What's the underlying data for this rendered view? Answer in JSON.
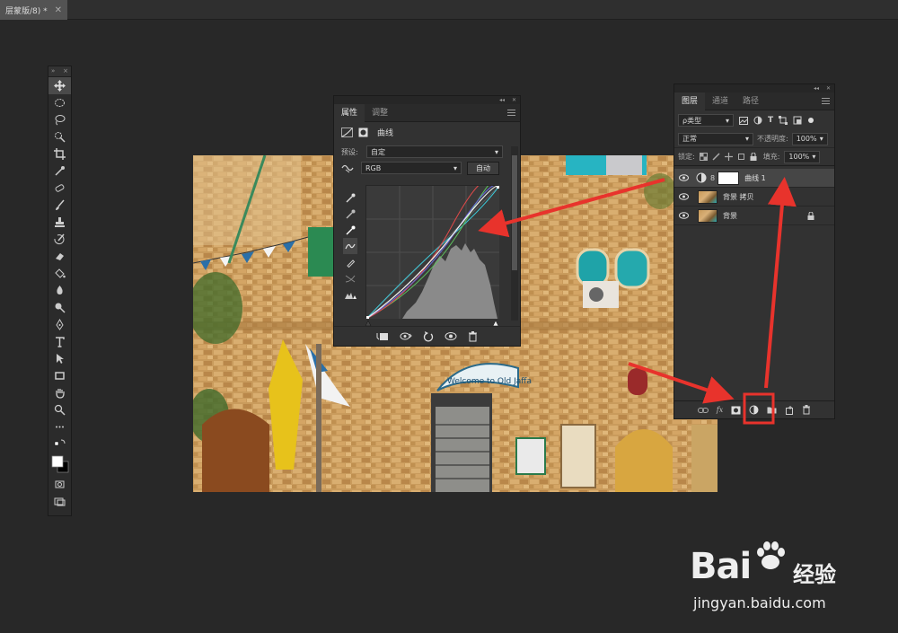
{
  "document": {
    "tab_title": "层蒙版/8) *",
    "close": "✕"
  },
  "properties_panel": {
    "tabs": [
      "属性",
      "调整"
    ],
    "type_label": "曲线",
    "preset_label": "预设:",
    "preset_value": "自定",
    "channel_value": "RGB",
    "auto_button": "自动"
  },
  "layers_panel": {
    "tabs": [
      "图层",
      "通道",
      "路径"
    ],
    "filter_value": "ρ类型",
    "blend_mode": "正常",
    "opacity_label": "不透明度:",
    "opacity_value": "100%",
    "lock_label": "锁定:",
    "fill_label": "填充:",
    "fill_value": "100%",
    "layers": [
      {
        "name": "曲线 1",
        "selected": true
      },
      {
        "name": "背景 拷贝",
        "selected": false
      },
      {
        "name": "背景",
        "selected": false
      }
    ],
    "bottom_fx": "fx"
  },
  "canvas": {
    "sign_text": "Welcome to Old Jaffa"
  },
  "watermark": {
    "brand": "Bai",
    "brand_suffix": "经验",
    "url": "jingyan.baidu.com"
  },
  "colors": {
    "annotation_red": "#e8332c",
    "panel_bg": "#323232",
    "workspace_bg": "#282828"
  }
}
